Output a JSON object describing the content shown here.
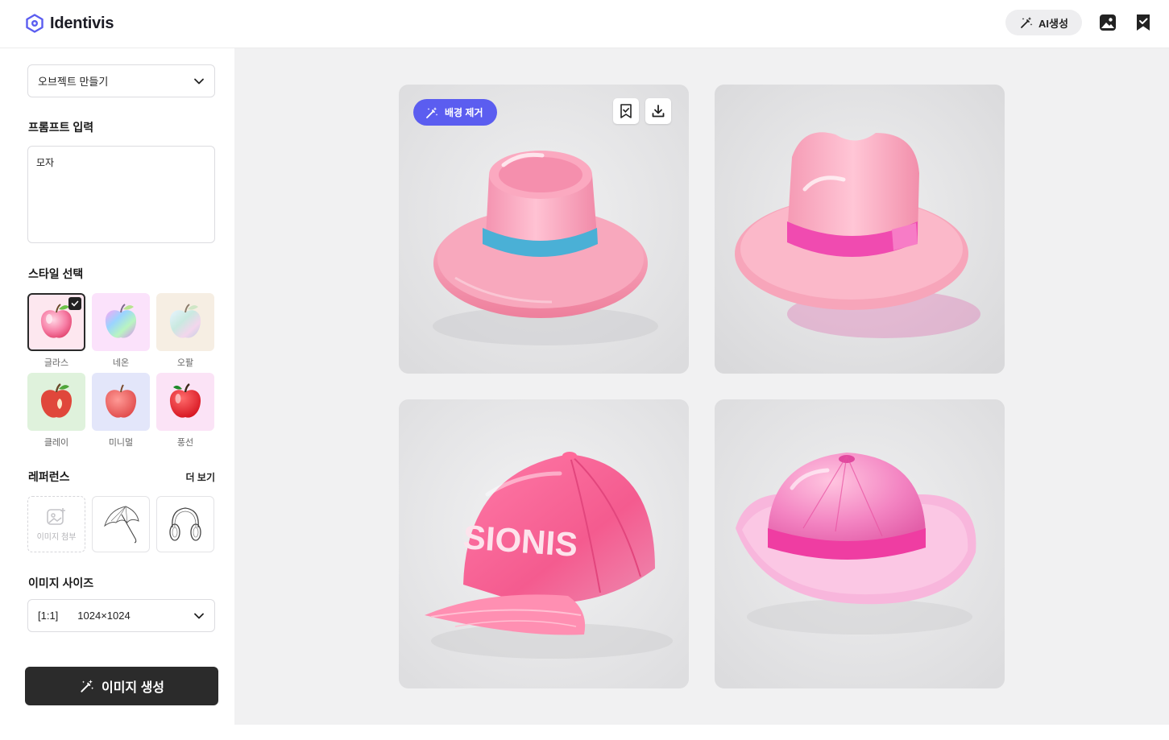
{
  "app": {
    "logo_text": "Identivis",
    "ai_button_label": "AI생성",
    "header_icons": [
      "gallery-icon",
      "bookmark-check-icon"
    ]
  },
  "sidebar": {
    "mode_select": {
      "value": "오브젝트 만들기"
    },
    "prompt": {
      "title": "프롬프트 입력",
      "value": "모자"
    },
    "style": {
      "title": "스타일 선택",
      "items": [
        {
          "label": "글라스",
          "selected": true,
          "bg": "#fde7ef"
        },
        {
          "label": "네온",
          "selected": false,
          "bg": "#fbe2fb"
        },
        {
          "label": "오팔",
          "selected": false,
          "bg": "#f6eee3"
        },
        {
          "label": "클레이",
          "selected": false,
          "bg": "#dff2dc"
        },
        {
          "label": "미니멀",
          "selected": false,
          "bg": "#e3e6fa"
        },
        {
          "label": "풍선",
          "selected": false,
          "bg": "#fbe3f6"
        }
      ]
    },
    "reference": {
      "title": "레퍼런스",
      "more_label": "더 보기",
      "attach_label": "이미지 첨부",
      "items": [
        "umbrella-sketch",
        "headphones-sketch"
      ]
    },
    "size": {
      "title": "이미지 사이즈",
      "ratio": "[1:1]",
      "dimensions": "1024×1024"
    },
    "generate_button_label": "이미지 생성"
  },
  "results": {
    "remove_bg_label": "배경 제거",
    "cards": [
      {
        "type": "fedora-blue-band",
        "has_toolbar": true
      },
      {
        "type": "fedora-magenta-band",
        "has_toolbar": false
      },
      {
        "type": "cap",
        "cap_text": "SIONIS",
        "has_toolbar": false
      },
      {
        "type": "bucket-hat",
        "has_toolbar": false
      }
    ]
  },
  "colors": {
    "accent": "#5b5df0",
    "dark_button": "#2b2b2b",
    "main_bg": "#f1f1f2",
    "hat_pink": "#f7a3bb"
  }
}
